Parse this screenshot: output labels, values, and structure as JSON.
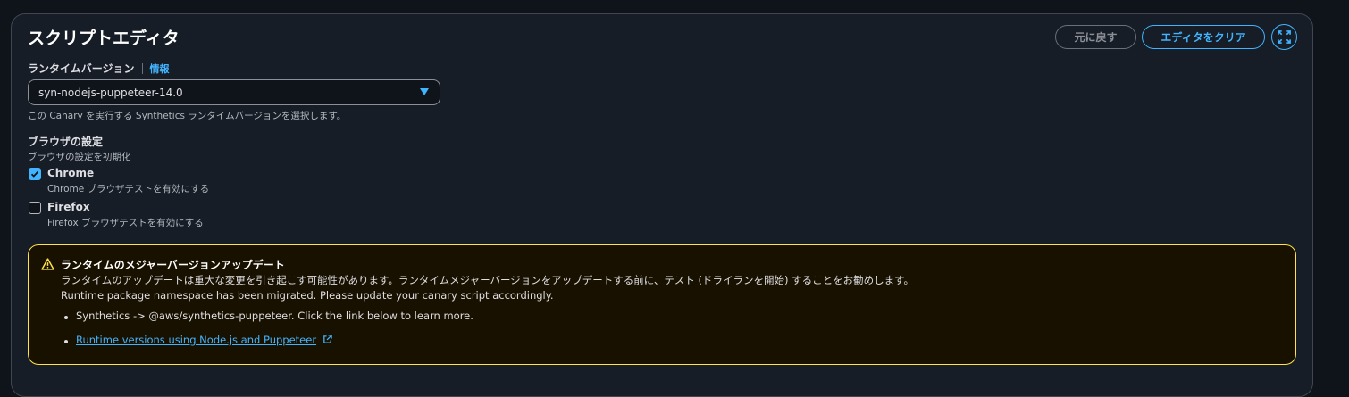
{
  "editor": {
    "title": "スクリプトエディタ",
    "undo_label": "元に戻す",
    "clear_label": "エディタをクリア"
  },
  "runtime": {
    "label": "ランタイムバージョン",
    "info_label": "情報",
    "selected": "syn-nodejs-puppeteer-14.0",
    "description": "この Canary を実行する Synthetics ランタイムバージョンを選択します。"
  },
  "browser": {
    "title": "ブラウザの設定",
    "subtitle": "ブラウザの設定を初期化",
    "options": [
      {
        "label": "Chrome",
        "description": "Chrome ブラウザテストを有効にする",
        "checked": true
      },
      {
        "label": "Firefox",
        "description": "Firefox ブラウザテストを有効にする",
        "checked": false
      }
    ]
  },
  "alert": {
    "title": "ランタイムのメジャーバージョンアップデート",
    "line1": "ランタイムのアップデートは重大な変更を引き起こす可能性があります。ランタイムメジャーバージョンをアップデートする前に、テスト (ドライランを開始) することをお勧めします。",
    "line2": "Runtime package namespace has been migrated. Please update your canary script accordingly.",
    "bullet1": "Synthetics -> @aws/synthetics-puppeteer. Click the link below to learn more.",
    "bullet2_link": "Runtime versions using Node.js and Puppeteer"
  },
  "colors": {
    "accent": "#42b4ff",
    "warning": "#ffe347"
  }
}
